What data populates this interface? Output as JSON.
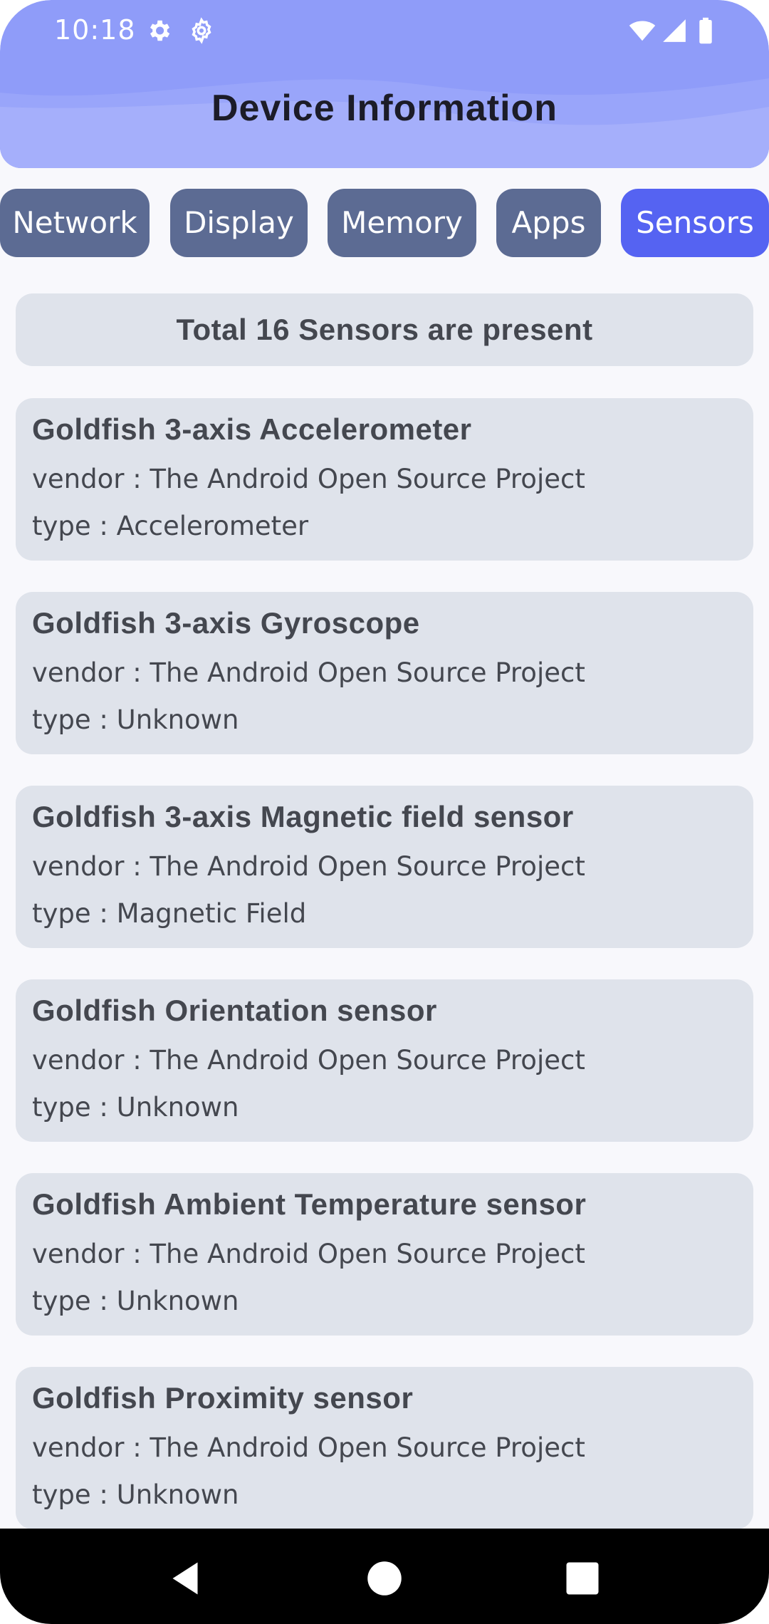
{
  "status_bar": {
    "time": "10:18",
    "left_icons": [
      "gear-icon",
      "settings-gear-icon"
    ],
    "right_icons": [
      "wifi-icon",
      "cell-signal-icon",
      "battery-icon"
    ]
  },
  "header": {
    "title": "Device Information"
  },
  "tabs": [
    {
      "label": "Network",
      "active": false
    },
    {
      "label": "Display",
      "active": false
    },
    {
      "label": "Memory",
      "active": false
    },
    {
      "label": "Apps",
      "active": false
    },
    {
      "label": "Sensors",
      "active": true
    }
  ],
  "summary": {
    "text": "Total 16 Sensors are present"
  },
  "sensors": [
    {
      "name": "Goldfish 3-axis Accelerometer",
      "vendor": "vendor : The Android Open Source Project",
      "type": "type : Accelerometer"
    },
    {
      "name": "Goldfish 3-axis Gyroscope",
      "vendor": "vendor : The Android Open Source Project",
      "type": "type : Unknown"
    },
    {
      "name": "Goldfish 3-axis Magnetic field sensor",
      "vendor": "vendor : The Android Open Source Project",
      "type": "type : Magnetic Field"
    },
    {
      "name": "Goldfish Orientation sensor",
      "vendor": "vendor : The Android Open Source Project",
      "type": "type : Unknown"
    },
    {
      "name": "Goldfish Ambient Temperature sensor",
      "vendor": "vendor : The Android Open Source Project",
      "type": "type : Unknown"
    },
    {
      "name": "Goldfish Proximity sensor",
      "vendor": "vendor : The Android Open Source Project",
      "type": "type : Unknown"
    }
  ],
  "navbar": {
    "buttons": [
      "back-icon",
      "home-icon",
      "recents-icon"
    ]
  },
  "colors": {
    "header": "#8f9cf9",
    "tab_inactive": "#5c6b93",
    "tab_active": "#5563f2",
    "card": "#dfe3eb",
    "card_text": "#44474f"
  }
}
